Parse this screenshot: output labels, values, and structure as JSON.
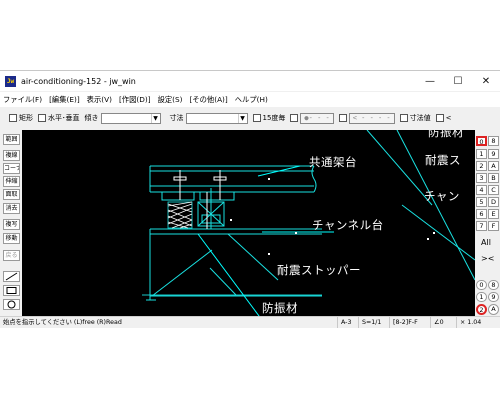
{
  "window": {
    "title": "air-conditioning-152 - jw_win",
    "icon_text": "Jw",
    "controls": {
      "minimize": "—",
      "maximize": "☐",
      "close": "✕"
    }
  },
  "menu": {
    "items": [
      "ファイル(F)",
      "[編集(E)]",
      "表示(V)",
      "[作図(D)]",
      "設定(S)",
      "[その他(A)]",
      "ヘルプ(H)"
    ]
  },
  "toolbar": {
    "rect_label": "矩形",
    "hv_label": "水平･垂直",
    "tilt_label": "傾き",
    "dim_label": "寸法",
    "deg15_label": "15度毎",
    "btn1_label": "●- - -",
    "btn2_label": "< - - - -",
    "dimval_label": "寸法値",
    "last_label": "<"
  },
  "leftpanel": {
    "buttons": [
      "範囲",
      "複線",
      "コーナー",
      "伸縮",
      "面取",
      "消去",
      "複写",
      "移動",
      "戻る"
    ]
  },
  "rightpanel": {
    "top_pair": [
      "0",
      "8"
    ],
    "rows": [
      [
        "1",
        "9"
      ],
      [
        "2",
        "A"
      ],
      [
        "3",
        "B"
      ],
      [
        "4",
        "C"
      ],
      [
        "5",
        "D"
      ],
      [
        "6",
        "E"
      ],
      [
        "7",
        "F"
      ]
    ],
    "all_label": "All",
    "xmark_label": "><",
    "circle_pair": [
      "0",
      "8"
    ],
    "circle_pair2": [
      "1",
      "9"
    ],
    "circle_pair3": [
      "2",
      "A"
    ]
  },
  "drawing": {
    "labels": {
      "frame": "共通架台",
      "channel": "チャンネル台",
      "stopper": "耐震ストッパー",
      "vibration": "防振材",
      "vibration_r": "防振材",
      "seismic_r": "耐震ス",
      "channel_r": "チャン"
    },
    "line_color": "#19e1e1",
    "leader_color": "#00ffff"
  },
  "status": {
    "message": "始点を指示してください (L)free (R)Read",
    "paper": "A-3",
    "scale": "S=1/1",
    "layer": "[8-2]F-F",
    "angle": "∠0",
    "zoom": "× 1.04"
  }
}
